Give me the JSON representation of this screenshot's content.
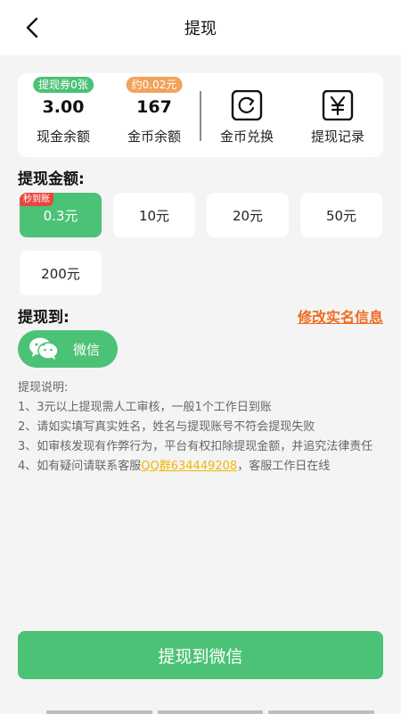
{
  "nav": {
    "title": "提现"
  },
  "stats": {
    "cash": {
      "badge": "提现券0张",
      "value": "3.00",
      "label": "现金余额",
      "badge_color": "#4cc276"
    },
    "coin": {
      "badge": "约0.02元",
      "value": "167",
      "label": "金币余额",
      "badge_color": "#f2a35b"
    },
    "exchange": {
      "label": "金币兑换",
      "icon": "refresh-icon"
    },
    "records": {
      "label": "提现记录",
      "icon": "yen-icon"
    }
  },
  "amount_section": {
    "title": "提现金额:",
    "options": [
      {
        "label": "0.3元",
        "tag": "秒到账",
        "selected": true
      },
      {
        "label": "10元"
      },
      {
        "label": "20元"
      },
      {
        "label": "50元"
      },
      {
        "label": "200元"
      }
    ]
  },
  "withdraw_to": {
    "title": "提现到:",
    "edit_link": "修改实名信息",
    "method": "微信"
  },
  "description": {
    "title": "提现说明:",
    "lines": [
      "1、3元以上提现需人工审核，一般1个工作日到账",
      "2、请如实填写真实姓名，姓名与提现账号不符会提现失败",
      "3、如审核发现有作弊行为，平台有权扣除提现金额，并追究法律责任"
    ],
    "line4_prefix": "4、如有疑问请联系客服",
    "line4_qq": "QQ群634449208",
    "line4_suffix": "，客服工作日在线"
  },
  "submit": {
    "label": "提现到微信"
  },
  "colors": {
    "accent": "#4cc276",
    "link": "#ef6c22",
    "tag": "#e8483f",
    "qq": "#f2b705"
  }
}
